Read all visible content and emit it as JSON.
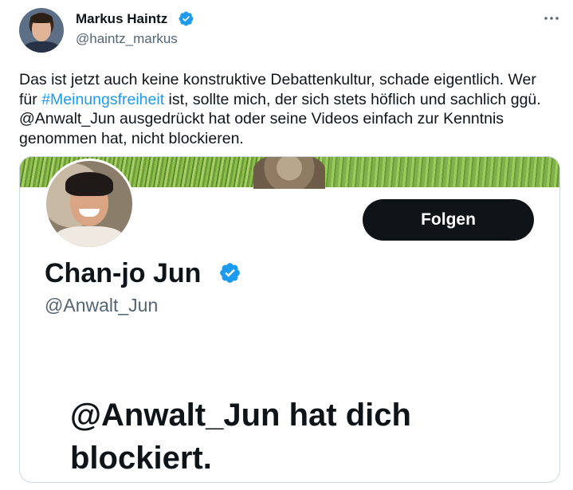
{
  "tweet": {
    "author": {
      "name": "Markus Haintz",
      "handle": "@haintz_markus",
      "verified": true
    },
    "more_icon": "more-horizontal-icon",
    "text_parts": {
      "before_hashtag": "Das ist jetzt auch keine konstruktive Debattenkultur, schade eigentlich. Wer für ",
      "hashtag": "#Meinungsfreiheit",
      "after_hashtag": " ist, sollte mich, der sich stets höflich und sachlich ggü. @Anwalt_Jun ausgedrückt hat oder seine Videos einfach zur Kenntnis genommen hat, nicht blockieren."
    }
  },
  "media": {
    "profile": {
      "name": "Chan-jo Jun",
      "handle": "@Anwalt_Jun",
      "verified": true,
      "follow_label": "Folgen"
    },
    "blocked_message": "@Anwalt_Jun hat dich blockiert."
  },
  "colors": {
    "link": "#1d9bf0",
    "verified_badge": "#1d9bf0",
    "secondary_text": "#536471",
    "primary_text": "#0f1419",
    "follow_button_bg": "#0f1419"
  }
}
